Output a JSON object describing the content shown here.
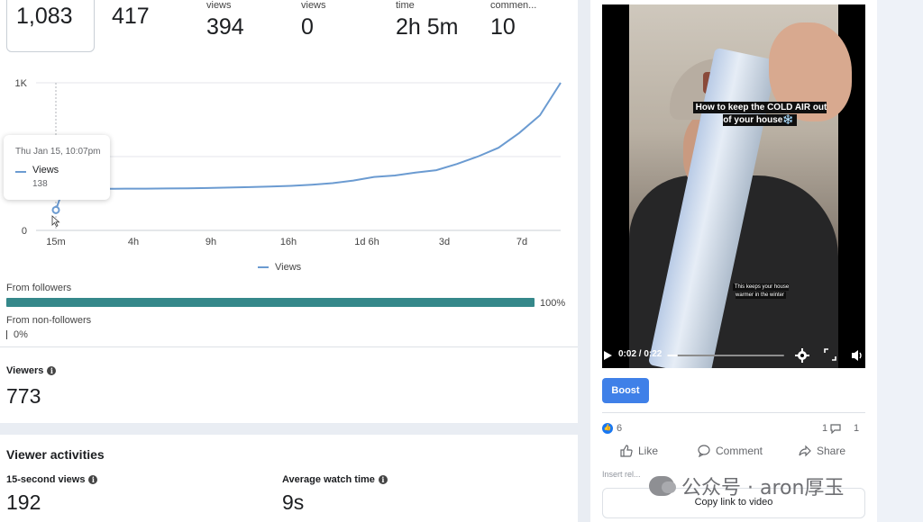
{
  "stats": {
    "items": [
      {
        "label": "",
        "value": "1,083"
      },
      {
        "label": "",
        "value": "417"
      },
      {
        "label": "views",
        "value": "394"
      },
      {
        "label": "views",
        "value": "0"
      },
      {
        "label": "time",
        "value": "2h 5m"
      },
      {
        "label": "commen...",
        "value": "10"
      }
    ]
  },
  "chart_data": {
    "type": "line",
    "y_tick_labels": [
      "1K",
      "0"
    ],
    "ylim": [
      0,
      1000
    ],
    "x_tick_labels": [
      "15m",
      "4h",
      "9h",
      "16h",
      "1d 6h",
      "3d",
      "7d"
    ],
    "series": [
      {
        "name": "Views",
        "values": [
          138,
          280,
          282,
          282,
          283,
          283,
          284,
          285,
          287,
          290,
          293,
          297,
          302,
          310,
          320,
          338,
          362,
          372,
          392,
          408,
          450,
          500,
          560,
          660,
          780,
          1000
        ]
      }
    ],
    "grid": true,
    "legend": "bottom-center",
    "color": "#6b9bd1"
  },
  "tooltip": {
    "date": "Thu Jan 15, 10:07pm",
    "series": "Views",
    "value": "138"
  },
  "legend": {
    "label": "Views"
  },
  "audience": {
    "followers": {
      "label": "From followers",
      "pct": "100%",
      "fraction": 1.0,
      "color": "#35888a"
    },
    "non_followers": {
      "label": "From non-followers",
      "pct": "0%",
      "fraction": 0.0
    }
  },
  "viewers": {
    "label": "Viewers",
    "value": "773"
  },
  "activities": {
    "title": "Viewer activities",
    "stats": [
      {
        "label": "15-second views",
        "value": "192"
      },
      {
        "label": "Average watch time",
        "value": "9s"
      }
    ]
  },
  "video": {
    "caption_top": "How to keep the COLD AIR out of your house❄️",
    "caption_bottom": "This keeps your house warmer in the winter",
    "time": "0:02 / 0:22",
    "progress": 0.09
  },
  "post": {
    "boost_label": "Boost",
    "reactions": "6",
    "comments": "1",
    "shares": "1",
    "like_label": "Like",
    "comment_label": "Comment",
    "share_label": "Share",
    "cut_text": "Insert rel...",
    "copy_link_label": "Copy link to video"
  },
  "watermark": {
    "text": "公众号 · aron厚玉"
  }
}
